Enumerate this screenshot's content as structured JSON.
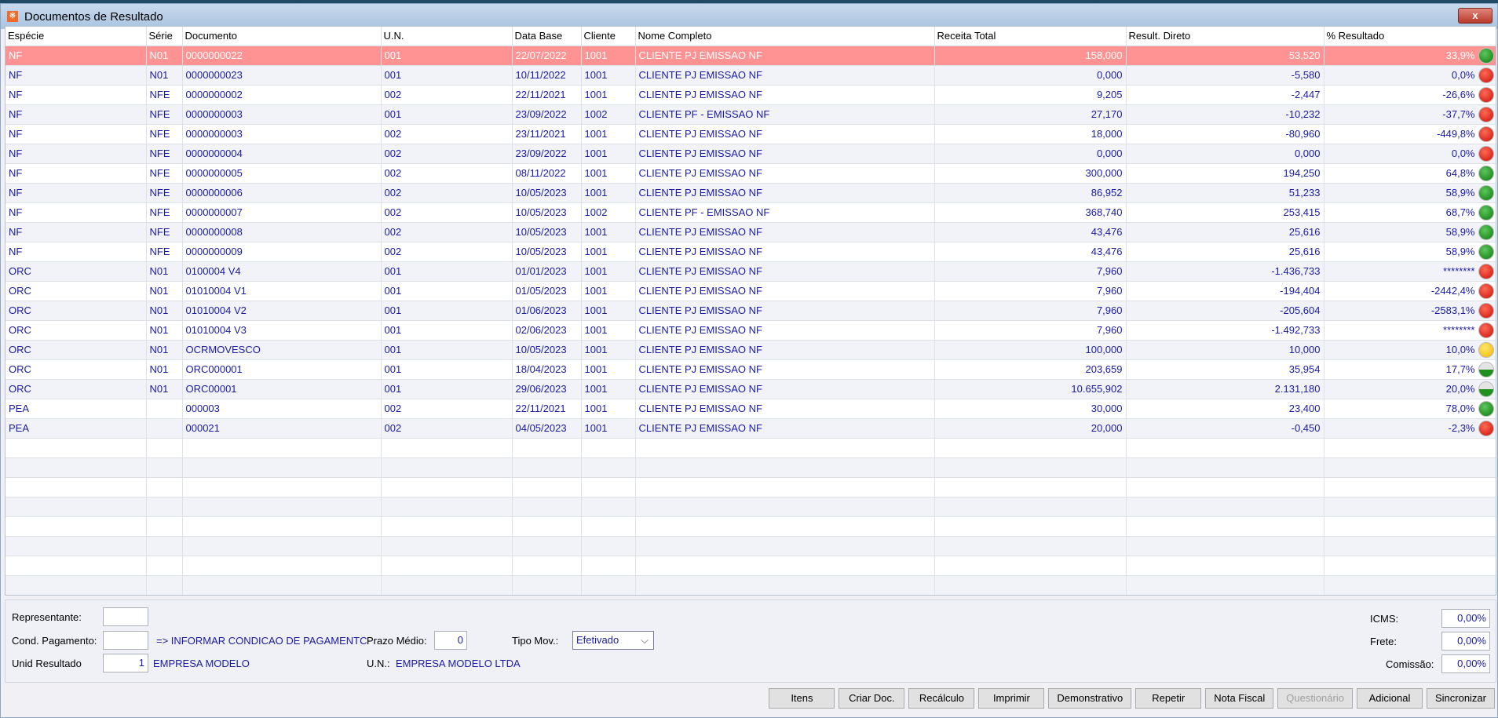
{
  "window": {
    "title": "Documentos de Resultado",
    "close": "x"
  },
  "columns": [
    "Espécie",
    "Série",
    "Documento",
    "U.N.",
    "Data Base",
    "Cliente",
    "Nome Completo",
    "Receita Total",
    "Result. Direto",
    "% Resultado"
  ],
  "rows": [
    [
      "NF",
      "N01",
      "0000000022",
      "001",
      "22/07/2022",
      "1001",
      "CLIENTE PJ EMISSAO NF",
      "158,000",
      "53,520",
      "33,9%",
      "green"
    ],
    [
      "NF",
      "N01",
      "0000000023",
      "001",
      "10/11/2022",
      "1001",
      "CLIENTE PJ EMISSAO NF",
      "0,000",
      "-5,580",
      "0,0%",
      "red"
    ],
    [
      "NF",
      "NFE",
      "0000000002",
      "002",
      "22/11/2021",
      "1001",
      "CLIENTE PJ EMISSAO NF",
      "9,205",
      "-2,447",
      "-26,6%",
      "red"
    ],
    [
      "NF",
      "NFE",
      "0000000003",
      "001",
      "23/09/2022",
      "1002",
      "CLIENTE PF - EMISSAO NF",
      "27,170",
      "-10,232",
      "-37,7%",
      "red"
    ],
    [
      "NF",
      "NFE",
      "0000000003",
      "002",
      "23/11/2021",
      "1001",
      "CLIENTE PJ EMISSAO NF",
      "18,000",
      "-80,960",
      "-449,8%",
      "red"
    ],
    [
      "NF",
      "NFE",
      "0000000004",
      "002",
      "23/09/2022",
      "1001",
      "CLIENTE PJ EMISSAO NF",
      "0,000",
      "0,000",
      "0,0%",
      "red"
    ],
    [
      "NF",
      "NFE",
      "0000000005",
      "002",
      "08/11/2022",
      "1001",
      "CLIENTE PJ EMISSAO NF",
      "300,000",
      "194,250",
      "64,8%",
      "green"
    ],
    [
      "NF",
      "NFE",
      "0000000006",
      "002",
      "10/05/2023",
      "1001",
      "CLIENTE PJ EMISSAO NF",
      "86,952",
      "51,233",
      "58,9%",
      "green"
    ],
    [
      "NF",
      "NFE",
      "0000000007",
      "002",
      "10/05/2023",
      "1002",
      "CLIENTE PF - EMISSAO NF",
      "368,740",
      "253,415",
      "68,7%",
      "green"
    ],
    [
      "NF",
      "NFE",
      "0000000008",
      "002",
      "10/05/2023",
      "1001",
      "CLIENTE PJ EMISSAO NF",
      "43,476",
      "25,616",
      "58,9%",
      "green"
    ],
    [
      "NF",
      "NFE",
      "0000000009",
      "002",
      "10/05/2023",
      "1001",
      "CLIENTE PJ EMISSAO NF",
      "43,476",
      "25,616",
      "58,9%",
      "green"
    ],
    [
      "ORC",
      "N01",
      "0100004 V4",
      "001",
      "01/01/2023",
      "1001",
      "CLIENTE PJ EMISSAO NF",
      "7,960",
      "-1.436,733",
      "********",
      "red"
    ],
    [
      "ORC",
      "N01",
      "01010004 V1",
      "001",
      "01/05/2023",
      "1001",
      "CLIENTE PJ EMISSAO NF",
      "7,960",
      "-194,404",
      "-2442,4%",
      "red"
    ],
    [
      "ORC",
      "N01",
      "01010004 V2",
      "001",
      "01/06/2023",
      "1001",
      "CLIENTE PJ EMISSAO NF",
      "7,960",
      "-205,604",
      "-2583,1%",
      "red"
    ],
    [
      "ORC",
      "N01",
      "01010004 V3",
      "001",
      "02/06/2023",
      "1001",
      "CLIENTE PJ EMISSAO NF",
      "7,960",
      "-1.492,733",
      "********",
      "red"
    ],
    [
      "ORC",
      "N01",
      "OCRMOVESCO",
      "001",
      "10/05/2023",
      "1001",
      "CLIENTE PJ EMISSAO NF",
      "100,000",
      "10,000",
      "10,0%",
      "yellow"
    ],
    [
      "ORC",
      "N01",
      "ORC000001",
      "001",
      "18/04/2023",
      "1001",
      "CLIENTE PJ EMISSAO NF",
      "203,659",
      "35,954",
      "17,7%",
      "half"
    ],
    [
      "ORC",
      "N01",
      "ORC00001",
      "001",
      "29/06/2023",
      "1001",
      "CLIENTE PJ EMISSAO NF",
      "10.655,902",
      "2.131,180",
      "20,0%",
      "half"
    ],
    [
      "PEA",
      "",
      "000003",
      "002",
      "22/11/2021",
      "1001",
      "CLIENTE PJ EMISSAO NF",
      "30,000",
      "23,400",
      "78,0%",
      "green"
    ],
    [
      "PEA",
      "",
      "000021",
      "002",
      "04/05/2023",
      "1001",
      "CLIENTE PJ EMISSAO NF",
      "20,000",
      "-0,450",
      "-2,3%",
      "red"
    ]
  ],
  "form": {
    "representante_label": "Representante:",
    "representante_value": "",
    "cond_label": "Cond. Pagamento:",
    "cond_value": "",
    "cond_msg": "=> INFORMAR CONDICAO DE PAGAMENTC",
    "prazo_label": "Prazo Médio:",
    "prazo_value": "0",
    "tipo_label": "Tipo Mov.:",
    "tipo_value": "Efetivado",
    "unid_label": "Unid Resultado",
    "unid_value": "1",
    "unid_name": "EMPRESA MODELO",
    "un_label": "U.N.:",
    "un_name": "EMPRESA MODELO LTDA",
    "icms_label": "ICMS:",
    "icms_value": "0,00%",
    "frete_label": "Frete:",
    "frete_value": "0,00%",
    "comissao_label": "Comissão:",
    "comissao_value": "0,00%"
  },
  "buttons": [
    "Itens",
    "Criar Doc.",
    "Recálculo",
    "Imprimir",
    "Demonstrativo",
    "Repetir",
    "Nota Fiscal",
    "Questionário",
    "Adicional",
    "Sincronizar"
  ],
  "disabled_buttons": [
    "Questionário"
  ]
}
